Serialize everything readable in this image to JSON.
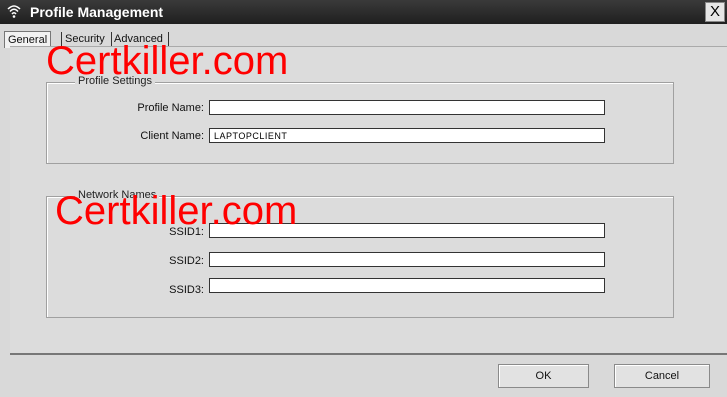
{
  "window": {
    "title": "Profile Management",
    "close_glyph": "X"
  },
  "tabs": [
    {
      "label": "General"
    },
    {
      "label": "Security"
    },
    {
      "label": "Advanced"
    }
  ],
  "profile_settings": {
    "title": "Profile Settings",
    "profile_name_label": "Profile Name:",
    "profile_name_value": "",
    "client_name_label": "Client Name:",
    "client_name_value": "LAPTOPCLIENT"
  },
  "network_names": {
    "title": "Network Names",
    "ssid1_label": "SSID1:",
    "ssid1_value": "",
    "ssid2_label": "SSID2:",
    "ssid2_value": "",
    "ssid3_label": "SSID3:",
    "ssid3_value": ""
  },
  "watermark": {
    "text": "Certkiller.com",
    "color": "#ff0000"
  },
  "buttons": {
    "ok": "OK",
    "cancel": "Cancel"
  },
  "icons": {
    "title_icon": "wireless-signal-icon",
    "close": "close-icon"
  }
}
